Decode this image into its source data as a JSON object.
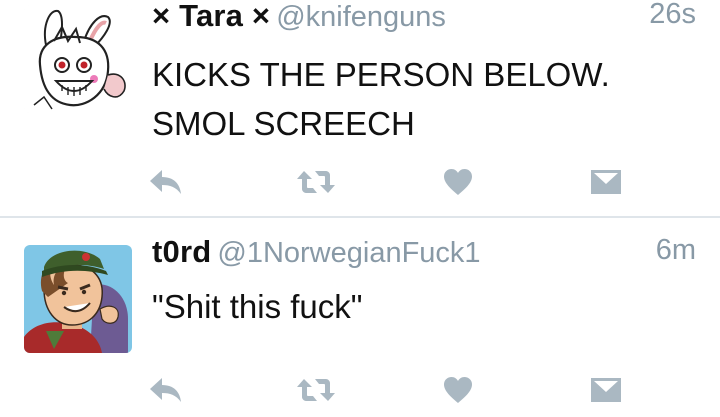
{
  "tweets": [
    {
      "display_name": "× Tara ×",
      "handle": "@knifenguns",
      "time": "26s",
      "text_lines": [
        "KICKS THE PERSON BELOW.",
        "SMOL SCREECH"
      ]
    },
    {
      "display_name": "t0rd",
      "handle": "@1NorwegianFuck1",
      "time": "6m",
      "text_lines": [
        "\"Shit this fuck\""
      ]
    }
  ],
  "icons": {
    "reply": "reply-icon",
    "retweet": "retweet-icon",
    "like": "heart-icon",
    "dm": "direct-message-icon"
  },
  "colors": {
    "text": "#111111",
    "secondary": "#8899a6",
    "icon": "#aab8c2",
    "divider": "#dfe5ea"
  }
}
